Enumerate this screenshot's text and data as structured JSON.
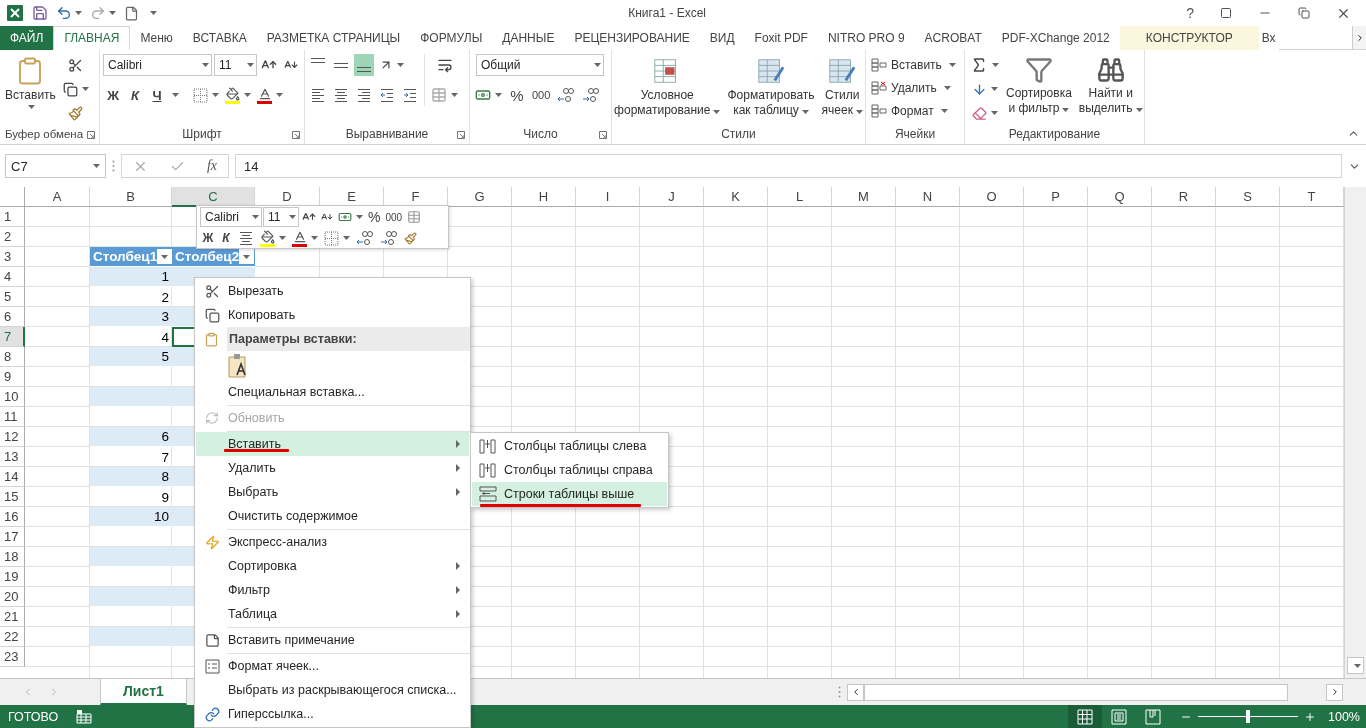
{
  "window": {
    "title": "Книга1 - Excel",
    "help": "?"
  },
  "tabs": [
    {
      "label": "ФАЙЛ",
      "kind": "file",
      "selected": false
    },
    {
      "label": "ГЛАВНАЯ",
      "kind": "normal",
      "selected": true
    },
    {
      "label": "Меню",
      "kind": "normal",
      "selected": false
    },
    {
      "label": "ВСТАВКА",
      "kind": "normal",
      "selected": false
    },
    {
      "label": "РАЗМЕТКА СТРАНИЦЫ",
      "kind": "normal",
      "selected": false
    },
    {
      "label": "ФОРМУЛЫ",
      "kind": "normal",
      "selected": false
    },
    {
      "label": "ДАННЫЕ",
      "kind": "normal",
      "selected": false
    },
    {
      "label": "РЕЦЕНЗИРОВАНИЕ",
      "kind": "normal",
      "selected": false
    },
    {
      "label": "ВИД",
      "kind": "normal",
      "selected": false
    },
    {
      "label": "Foxit PDF",
      "kind": "normal",
      "selected": false
    },
    {
      "label": "NITRO PRO 9",
      "kind": "normal",
      "selected": false
    },
    {
      "label": "ACROBAT",
      "kind": "normal",
      "selected": false
    },
    {
      "label": "PDF-XChange 2012",
      "kind": "normal",
      "selected": false
    },
    {
      "label": "КОНСТРУКТОР",
      "kind": "contextual",
      "selected": false
    },
    {
      "label": "Вх",
      "kind": "normal",
      "selected": false
    }
  ],
  "ribbon": [
    {
      "kind": "clipboard",
      "label": "Буфер обмена",
      "paste": "Вставить"
    },
    {
      "kind": "font",
      "label": "Шрифт",
      "font": "Calibri",
      "size": "11",
      "bold": "Ж",
      "italic": "К",
      "underline": "Ч"
    },
    {
      "kind": "alignment",
      "label": "Выравнивание",
      "vertical": [
        {
          "selected": false
        },
        {
          "selected": false
        },
        {
          "selected": true
        }
      ]
    },
    {
      "kind": "number",
      "label": "Число",
      "format": "Общий",
      "percent": "%",
      "thousands": "000"
    },
    {
      "kind": "styles",
      "label": "Стили",
      "buttons": [
        {
          "lines": [
            "Условное",
            "форматирование"
          ]
        },
        {
          "lines": [
            "Форматировать",
            "как таблицу"
          ]
        },
        {
          "lines": [
            "Стили",
            "ячеек"
          ]
        }
      ]
    },
    {
      "kind": "cells",
      "label": "Ячейки",
      "buttons": [
        "Вставить",
        "Удалить",
        "Формат"
      ]
    },
    {
      "kind": "editing",
      "label": "Редактирование",
      "buttons": [
        {
          "lines": [
            "Сортировка",
            "и фильтр"
          ]
        },
        {
          "lines": [
            "Найти и",
            "выделить"
          ]
        }
      ]
    }
  ],
  "formula_bar": {
    "name_box": "C7",
    "function_label": "fx",
    "value": "14"
  },
  "mini_toolbar": {
    "font": "Calibri",
    "size": "11",
    "percent": "%",
    "thousands": "000",
    "bold": "Ж",
    "italic": "К"
  },
  "sheet": {
    "columns": [
      {
        "label": "A",
        "selected": false,
        "in_table": false
      },
      {
        "label": "B",
        "selected": false,
        "in_table": true
      },
      {
        "label": "C",
        "selected": true,
        "in_table": true
      },
      {
        "label": "D",
        "selected": false,
        "in_table": false
      },
      {
        "label": "E",
        "selected": false,
        "in_table": false
      },
      {
        "label": "F",
        "selected": false,
        "in_table": false
      },
      {
        "label": "G",
        "selected": false,
        "in_table": false
      },
      {
        "label": "H",
        "selected": false,
        "in_table": false
      },
      {
        "label": "I",
        "selected": false,
        "in_table": false
      },
      {
        "label": "J",
        "selected": false,
        "in_table": false
      },
      {
        "label": "K",
        "selected": false,
        "in_table": false
      },
      {
        "label": "L",
        "selected": false,
        "in_table": false
      },
      {
        "label": "M",
        "selected": false,
        "in_table": false
      },
      {
        "label": "N",
        "selected": false,
        "in_table": false
      },
      {
        "label": "O",
        "selected": false,
        "in_table": false
      },
      {
        "label": "P",
        "selected": false,
        "in_table": false
      },
      {
        "label": "Q",
        "selected": false,
        "in_table": false
      },
      {
        "label": "R",
        "selected": false,
        "in_table": false
      },
      {
        "label": "S",
        "selected": false,
        "in_table": false
      },
      {
        "label": "T",
        "selected": false,
        "in_table": false
      }
    ],
    "rows": [
      {
        "label": "1",
        "selected": false,
        "kind": "empty"
      },
      {
        "label": "2",
        "selected": false,
        "kind": "empty"
      },
      {
        "label": "3",
        "selected": false,
        "kind": "header",
        "column_b": "Столбец1",
        "column_c": "Столбец2"
      },
      {
        "label": "4",
        "selected": false,
        "kind": "band",
        "column_b": "1"
      },
      {
        "label": "5",
        "selected": false,
        "kind": "plain",
        "column_b": "2"
      },
      {
        "label": "6",
        "selected": false,
        "kind": "band",
        "column_b": "3"
      },
      {
        "label": "7",
        "selected": true,
        "kind": "plain",
        "column_b": "4"
      },
      {
        "label": "8",
        "selected": false,
        "kind": "band",
        "column_b": "5"
      },
      {
        "label": "9",
        "selected": false,
        "kind": "plain"
      },
      {
        "label": "10",
        "selected": false,
        "kind": "band"
      },
      {
        "label": "11",
        "selected": false,
        "kind": "plain"
      },
      {
        "label": "12",
        "selected": false,
        "kind": "band",
        "column_b": "6"
      },
      {
        "label": "13",
        "selected": false,
        "kind": "plain",
        "column_b": "7"
      },
      {
        "label": "14",
        "selected": false,
        "kind": "band",
        "column_b": "8"
      },
      {
        "label": "15",
        "selected": false,
        "kind": "plain",
        "column_b": "9"
      },
      {
        "label": "16",
        "selected": false,
        "kind": "band",
        "column_b": "10"
      },
      {
        "label": "17",
        "selected": false,
        "kind": "plain"
      },
      {
        "label": "18",
        "selected": false,
        "kind": "band"
      },
      {
        "label": "19",
        "selected": false,
        "kind": "plain"
      },
      {
        "label": "20",
        "selected": false,
        "kind": "band"
      },
      {
        "label": "21",
        "selected": false,
        "kind": "plain"
      },
      {
        "label": "22",
        "selected": false,
        "kind": "band"
      },
      {
        "label": "23",
        "selected": false,
        "kind": "empty"
      }
    ],
    "sheet_tabs": [
      {
        "label": "Лист1",
        "selected": true
      }
    ]
  },
  "context_menu": {
    "items": [
      {
        "kind": "item",
        "label": "Вырезать",
        "disabled": false,
        "selected": false,
        "submenu": false,
        "underlined": false
      },
      {
        "kind": "item",
        "label": "Копировать",
        "disabled": false,
        "selected": false,
        "submenu": false,
        "underlined": false
      },
      {
        "kind": "header",
        "label": "Параметры вставки:"
      },
      {
        "kind": "paste_options"
      },
      {
        "kind": "item",
        "label": "Специальная вставка...",
        "disabled": false,
        "selected": false,
        "submenu": false,
        "underlined": false
      },
      {
        "kind": "separator"
      },
      {
        "kind": "item",
        "label": "Обновить",
        "disabled": true,
        "selected": false,
        "submenu": false,
        "underlined": false
      },
      {
        "kind": "separator"
      },
      {
        "kind": "item",
        "label": "Вставить",
        "disabled": false,
        "selected": true,
        "submenu": true,
        "underlined": true
      },
      {
        "kind": "item",
        "label": "Удалить",
        "disabled": false,
        "selected": false,
        "submenu": true,
        "underlined": false
      },
      {
        "kind": "item",
        "label": "Выбрать",
        "disabled": false,
        "selected": false,
        "submenu": true,
        "underlined": false
      },
      {
        "kind": "item",
        "label": "Очистить содержимое",
        "disabled": false,
        "selected": false,
        "submenu": false,
        "underlined": false
      },
      {
        "kind": "separator"
      },
      {
        "kind": "item",
        "label": "Экспресс-анализ",
        "disabled": false,
        "selected": false,
        "submenu": false,
        "underlined": false
      },
      {
        "kind": "item",
        "label": "Сортировка",
        "disabled": false,
        "selected": false,
        "submenu": true,
        "underlined": false
      },
      {
        "kind": "item",
        "label": "Фильтр",
        "disabled": false,
        "selected": false,
        "submenu": true,
        "underlined": false
      },
      {
        "kind": "item",
        "label": "Таблица",
        "disabled": false,
        "selected": false,
        "submenu": true,
        "underlined": false
      },
      {
        "kind": "separator"
      },
      {
        "kind": "item",
        "label": "Вставить примечание",
        "disabled": false,
        "selected": false,
        "submenu": false,
        "underlined": false
      },
      {
        "kind": "separator"
      },
      {
        "kind": "item",
        "label": "Формат ячеек...",
        "disabled": false,
        "selected": false,
        "submenu": false,
        "underlined": false
      },
      {
        "kind": "item",
        "label": "Выбрать из раскрывающегося списка...",
        "disabled": false,
        "selected": false,
        "submenu": false,
        "underlined": false
      },
      {
        "kind": "item",
        "label": "Гиперссылка...",
        "disabled": false,
        "selected": false,
        "submenu": false,
        "underlined": false
      }
    ]
  },
  "submenu": {
    "items": [
      {
        "label": "Столбцы таблицы слева",
        "selected": false,
        "underlined": false
      },
      {
        "label": "Столбцы таблицы справа",
        "selected": false,
        "underlined": false
      },
      {
        "label": "Строки таблицы выше",
        "selected": true,
        "underlined": true
      }
    ]
  },
  "status_bar": {
    "status": "ГОТОВО",
    "views": [
      {
        "selected": true
      },
      {
        "selected": false
      },
      {
        "selected": false
      }
    ],
    "zoom": {
      "level": 0.5,
      "reading": "100%"
    }
  }
}
